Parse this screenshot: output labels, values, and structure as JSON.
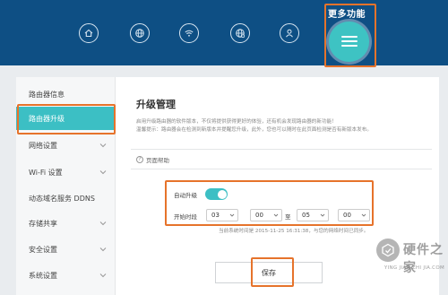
{
  "header": {
    "nav_icons": [
      "home-icon",
      "globe-icon",
      "wifi-icon",
      "globe-settings-icon",
      "user-icon"
    ],
    "more_label": "更多功能",
    "more_icon": "menu-icon",
    "accent_color": "#3ec3c3",
    "bar_color": "#0e4f84",
    "highlight_color": "#e6732b"
  },
  "sidebar": {
    "items": [
      {
        "label": "路由器信息",
        "has_chevron": false
      },
      {
        "label": "路由器升级",
        "has_chevron": false,
        "active": true
      },
      {
        "label": "网络设置",
        "has_chevron": true
      },
      {
        "label": "Wi-Fi 设置",
        "has_chevron": true
      },
      {
        "label": "动态域名服务 DDNS",
        "has_chevron": false
      },
      {
        "label": "存储共享",
        "has_chevron": true
      },
      {
        "label": "安全设置",
        "has_chevron": true
      },
      {
        "label": "系统设置",
        "has_chevron": true
      }
    ]
  },
  "main": {
    "title": "升级管理",
    "desc_line1": "启用升级路由器的软件版本，不仅将提供获得更好的体验，还有机会发现路由器的新功能！",
    "desc_line2": "温馨提示：路由器会在检测到新版本并提醒您升级，此外，您也可以随时在此页面检测是否有新版本发布。",
    "help_label": "页面帮助",
    "auto_upgrade_label": "自动升级",
    "auto_upgrade_on": true,
    "period_label": "开始时段",
    "start_hour": "03",
    "start_minute": "00",
    "to_label": "至",
    "end_hour": "05",
    "end_minute": "00",
    "status_text": "当前系统时间是 2015-11-25 16:31:38，与您的网络时间已同步。",
    "save_label": "保存"
  },
  "watermark": {
    "main": "硬件之家",
    "sub": "YING JIAN ZHI JIA.COM"
  }
}
